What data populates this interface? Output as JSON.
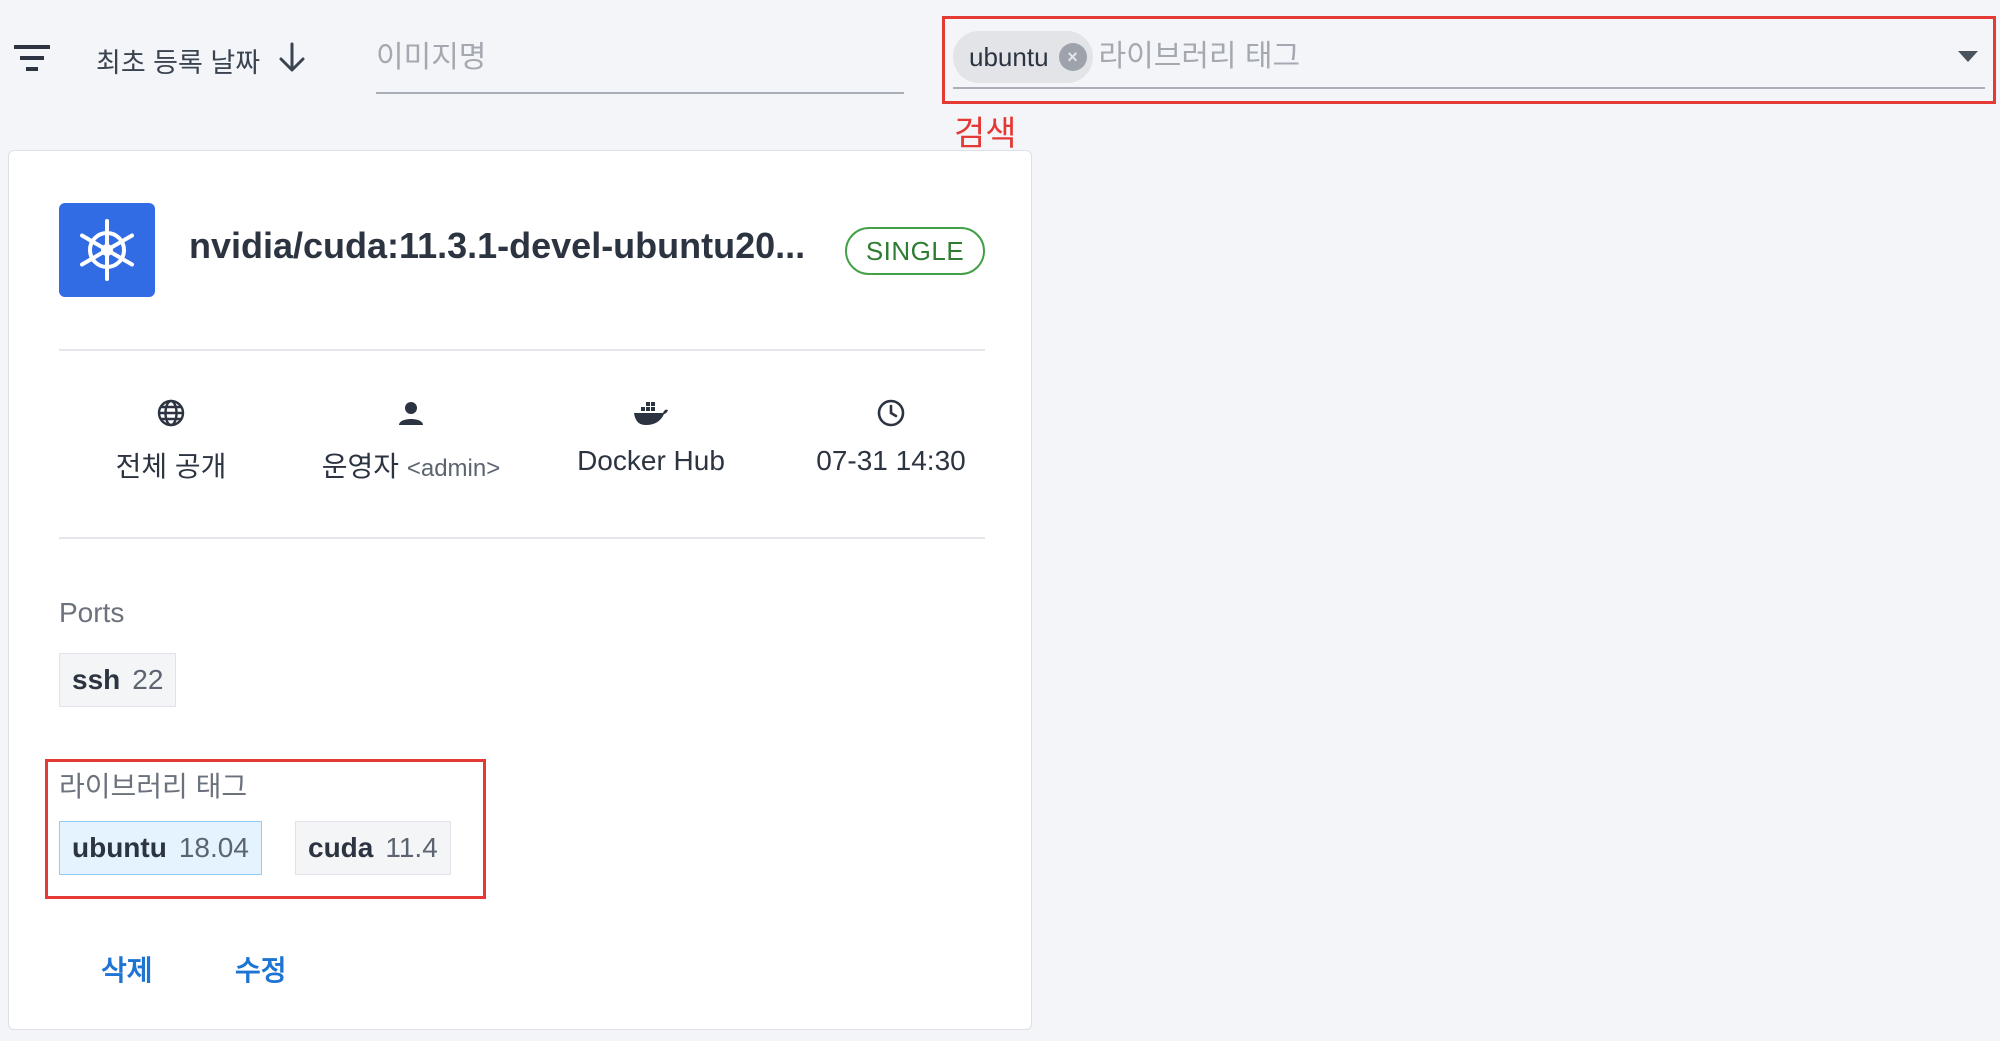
{
  "toolbar": {
    "sort_label": "최초 등록 날짜",
    "name_placeholder": "이미지명",
    "tag_chip": "ubuntu",
    "tag_placeholder": "라이브러리 태그",
    "search_annotation": "검색",
    "annotation_color": "#e53935"
  },
  "card": {
    "title": "nvidia/cuda:11.3.1-devel-ubuntu20...",
    "badge": "SINGLE",
    "meta": [
      {
        "icon": "globe-icon",
        "text": "전체 공개",
        "sub": ""
      },
      {
        "icon": "user-icon",
        "text": "운영자",
        "sub": "<admin>"
      },
      {
        "icon": "docker-icon",
        "text": "Docker Hub",
        "sub": ""
      },
      {
        "icon": "clock-icon",
        "text": "07-31 14:30",
        "sub": ""
      }
    ],
    "ports_label": "Ports",
    "ports": [
      {
        "key": "ssh",
        "value": "22"
      }
    ],
    "library_tags_label": "라이브러리 태그",
    "library_tags": [
      {
        "key": "ubuntu",
        "value": "18.04",
        "highlighted": true
      },
      {
        "key": "cuda",
        "value": "11.4",
        "highlighted": false
      }
    ],
    "actions": {
      "delete": "삭제",
      "edit": "수정"
    }
  },
  "colors": {
    "brand": "#326ce5",
    "link": "#1e74d2",
    "badge": "#2e7d32",
    "highlight_tag": "#e4f3fd"
  }
}
